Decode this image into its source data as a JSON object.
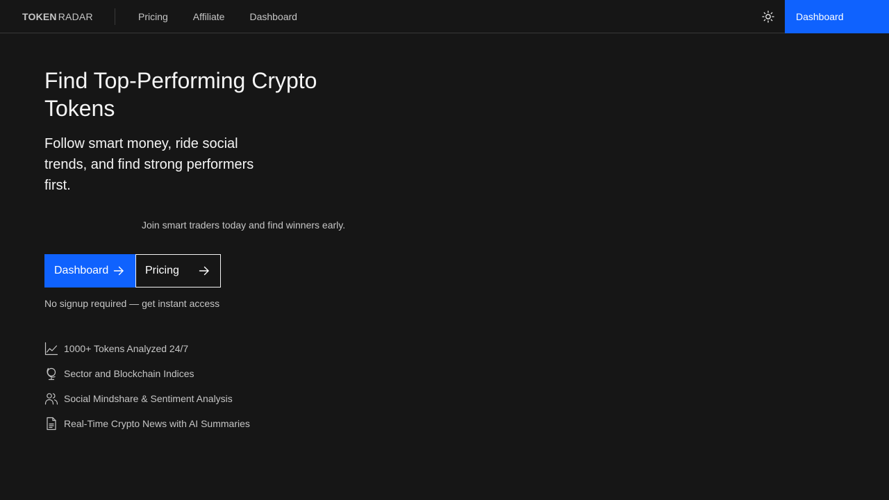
{
  "header": {
    "brand_part1": "TOKEN",
    "brand_part2": "RADAR",
    "nav": [
      "Pricing",
      "Affiliate",
      "Dashboard"
    ],
    "theme_icon": "sun-icon",
    "cta_label": "Dashboard"
  },
  "hero": {
    "title": "Find Top-Performing Crypto Tokens",
    "subtitle": "Follow smart money, ride social trends, and find strong performers first.",
    "join_text": "Join smart traders today and find winners early.",
    "primary_button": "Dashboard",
    "secondary_button": "Pricing",
    "note": "No signup required — get instant access"
  },
  "features": [
    {
      "icon": "chart-icon",
      "label": "1000+ Tokens Analyzed 24/7"
    },
    {
      "icon": "globe-icon",
      "label": "Sector and Blockchain Indices"
    },
    {
      "icon": "users-icon",
      "label": "Social Mindshare & Sentiment Analysis"
    },
    {
      "icon": "document-icon",
      "label": "Real-Time Crypto News with AI Summaries"
    }
  ],
  "colors": {
    "background": "#161616",
    "accent": "#0f62fe",
    "text": "#f4f4f4",
    "muted_text": "#c6c6c6"
  }
}
